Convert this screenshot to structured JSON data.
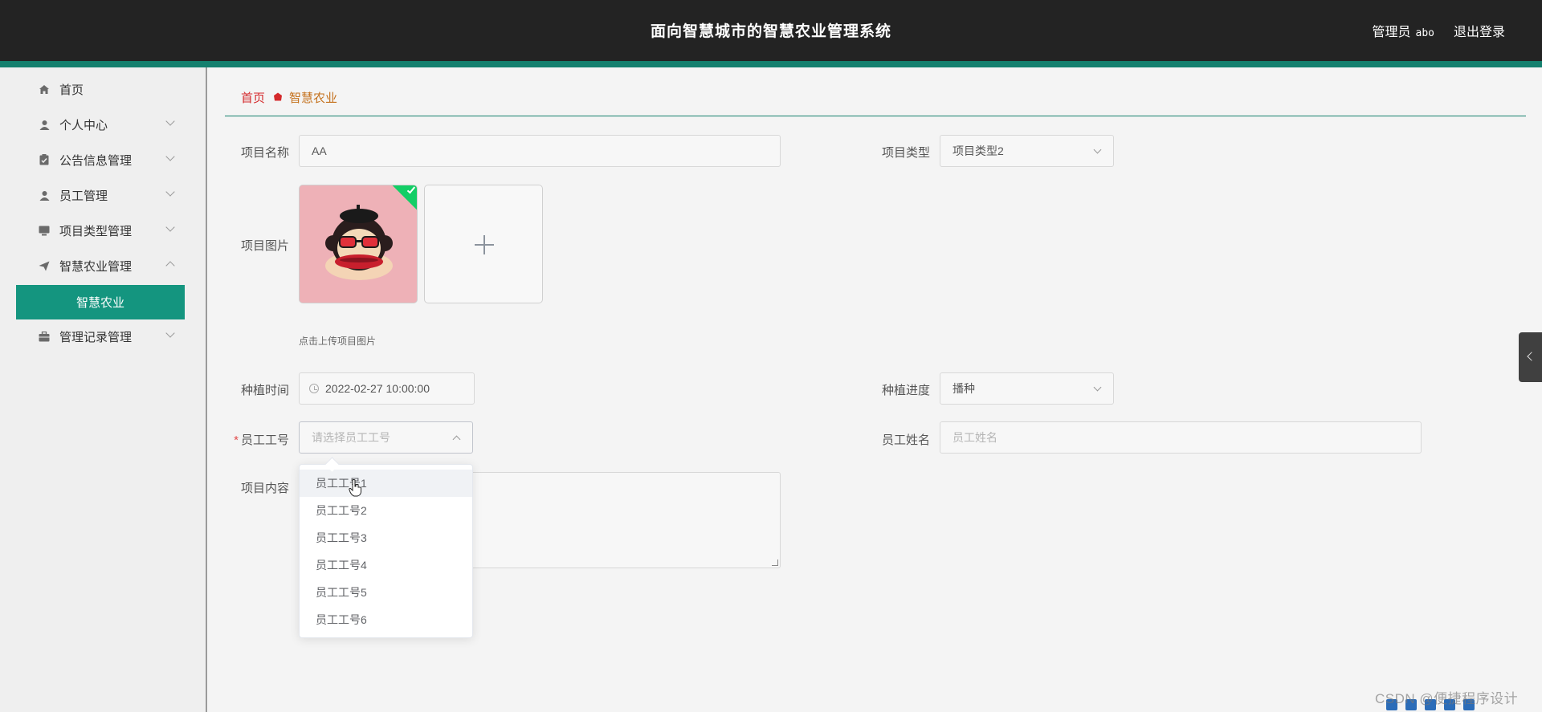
{
  "header": {
    "title": "面向智慧城市的智慧农业管理系统",
    "user_role": "管理员",
    "user_name": "abo",
    "logout_label": "退出登录"
  },
  "sidebar": {
    "items": [
      {
        "label": "首页",
        "icon": "home-icon"
      },
      {
        "label": "个人中心",
        "icon": "user-icon"
      },
      {
        "label": "公告信息管理",
        "icon": "clipboard-icon"
      },
      {
        "label": "员工管理",
        "icon": "user-icon"
      },
      {
        "label": "项目类型管理",
        "icon": "monitor-icon"
      },
      {
        "label": "智慧农业管理",
        "icon": "send-icon"
      },
      {
        "label": "管理记录管理",
        "icon": "briefcase-icon"
      }
    ],
    "active_sub": "智慧农业"
  },
  "breadcrumb": {
    "home": "首页",
    "current": "智慧农业"
  },
  "form": {
    "project_name_label": "项目名称",
    "project_name_value": "AA",
    "project_type_label": "项目类型",
    "project_type_value": "项目类型2",
    "project_image_label": "项目图片",
    "upload_hint": "点击上传项目图片",
    "plant_time_label": "种植时间",
    "plant_time_value": "2022-02-27 10:00:00",
    "plant_progress_label": "种植进度",
    "plant_progress_value": "播种",
    "employee_no_label": "员工工号",
    "employee_no_placeholder": "请选择员工工号",
    "employee_name_label": "员工姓名",
    "employee_name_placeholder": "员工姓名",
    "content_label": "项目内容"
  },
  "dropdown": {
    "options": [
      "员工工号1",
      "员工工号2",
      "员工工号3",
      "员工工号4",
      "员工工号5",
      "员工工号6"
    ],
    "hovered_index": 0
  },
  "watermark": "CSDN @便捷程序设计",
  "colors": {
    "header_bg": "#232323",
    "accent": "#14957f",
    "breadcrumb_home": "#d4292b",
    "breadcrumb_current": "#c4701b"
  }
}
